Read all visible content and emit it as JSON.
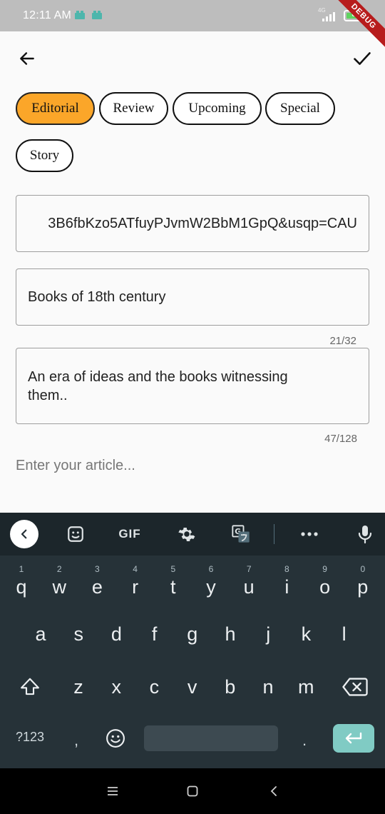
{
  "status_bar": {
    "time": "12:11 AM",
    "network": "4G",
    "battery_level": "82",
    "battery_fraction": 0.82,
    "debug_label": "DEBUG"
  },
  "app_bar": {
    "back_icon": "arrow-left-icon",
    "confirm_icon": "check-icon"
  },
  "categories": {
    "items": [
      "Editorial",
      "Review",
      "Upcoming",
      "Special",
      "Story"
    ],
    "selected": "Editorial",
    "accent_color": "#fba629"
  },
  "form": {
    "image_url_value": "3B6fbKzo5ATfuyPJvmW2BbM1GpQ&usqp=CAU",
    "title_value": "Books of 18th century",
    "title_counter": "21/32",
    "description_value_line1": "An era of ideas and the books witnessing",
    "description_value_line2": "them..",
    "description_counter": "47/128",
    "article_placeholder": "Enter your article..."
  },
  "keyboard": {
    "toolbar": {
      "gif_label": "GIF"
    },
    "row1": [
      {
        "hint": "1",
        "key": "q"
      },
      {
        "hint": "2",
        "key": "w"
      },
      {
        "hint": "3",
        "key": "e"
      },
      {
        "hint": "4",
        "key": "r"
      },
      {
        "hint": "5",
        "key": "t"
      },
      {
        "hint": "6",
        "key": "y"
      },
      {
        "hint": "7",
        "key": "u"
      },
      {
        "hint": "8",
        "key": "i"
      },
      {
        "hint": "9",
        "key": "o"
      },
      {
        "hint": "0",
        "key": "p"
      }
    ],
    "row2": [
      "a",
      "s",
      "d",
      "f",
      "g",
      "h",
      "j",
      "k",
      "l"
    ],
    "row3": [
      "z",
      "x",
      "c",
      "v",
      "b",
      "n",
      "m"
    ],
    "bottom": {
      "symbols_label": "?123",
      "comma": ",",
      "period": "."
    },
    "enter_color": "#80cbc4"
  }
}
